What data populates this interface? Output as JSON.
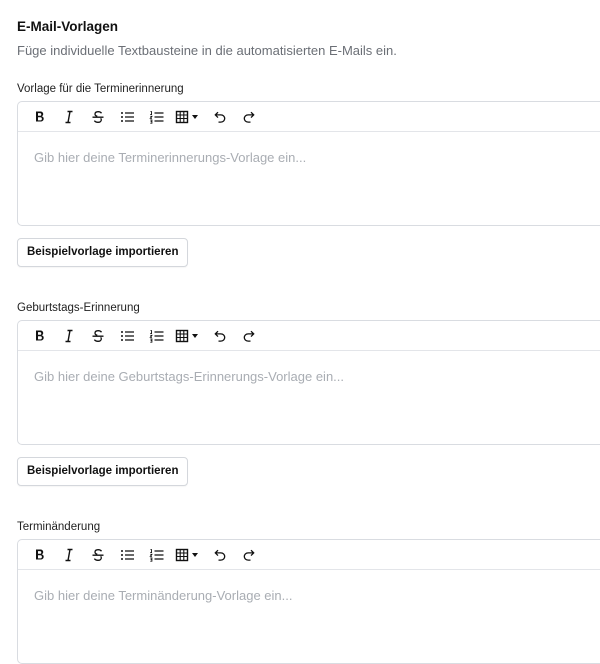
{
  "section": {
    "title": "E-Mail-Vorlagen",
    "description": "Füge individuelle Textbausteine in die automatisierten E-Mails ein."
  },
  "toolbar": {
    "bold": "B",
    "italic": "I",
    "strike": "S"
  },
  "templates": [
    {
      "label": "Vorlage für die Terminerinnerung",
      "placeholder": "Gib hier deine Terminerinnerungs-Vorlage ein...",
      "button": "Beispielvorlage importieren"
    },
    {
      "label": "Geburtstags-Erinnerung",
      "placeholder": "Gib hier deine Geburtstags-Erinnerungs-Vorlage ein...",
      "button": "Beispielvorlage importieren"
    },
    {
      "label": "Terminänderung",
      "placeholder": "Gib hier deine Terminänderung-Vorlage ein..."
    }
  ]
}
